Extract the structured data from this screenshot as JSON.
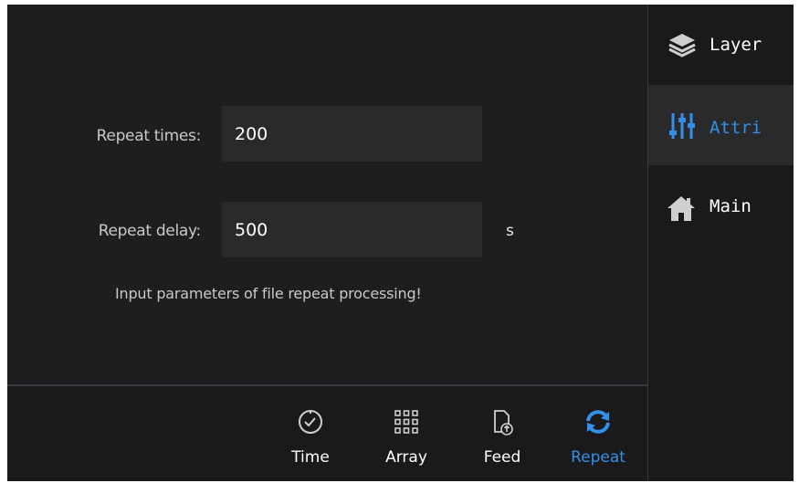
{
  "form": {
    "repeat_times": {
      "label": "Repeat times:",
      "value": "200"
    },
    "repeat_delay": {
      "label": "Repeat delay:",
      "value": "500",
      "unit": "s"
    },
    "hint": "Input  parameters of file repeat processing!"
  },
  "bottom_tabs": [
    {
      "label": "Time",
      "icon": "clock-icon",
      "active": false
    },
    {
      "label": "Array",
      "icon": "grid-icon",
      "active": false
    },
    {
      "label": "Feed",
      "icon": "file-upload-icon",
      "active": false
    },
    {
      "label": "Repeat",
      "icon": "repeat-icon",
      "active": true
    }
  ],
  "sidebar": [
    {
      "label": "Layer",
      "icon": "layers-icon",
      "active": false
    },
    {
      "label": "Attri",
      "icon": "sliders-icon",
      "active": true
    },
    {
      "label": "Main",
      "icon": "home-icon",
      "active": false
    }
  ],
  "colors": {
    "accent": "#3390e8",
    "background": "#1e1e20",
    "input_bg": "#2a2a2c",
    "sidebar_bg": "#1a1a1c"
  }
}
